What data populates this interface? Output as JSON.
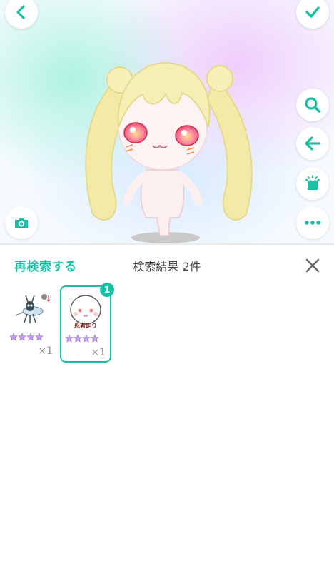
{
  "toolbar": {
    "back_icon": "chevron-left-icon",
    "confirm_icon": "checkmark-icon",
    "search_icon": "search-icon",
    "undo_icon": "arrow-left-icon",
    "outfit_icon": "shirt-sparkle-icon",
    "camera_icon": "camera-icon",
    "more_icon": "more-dots-icon",
    "accent_color": "#19c0a6"
  },
  "results_panel": {
    "research_label": "再検索する",
    "title": "検索結果 2件",
    "close_icon": "close-icon"
  },
  "items": [
    {
      "icon": "mosquito-item-icon",
      "rarity_stars": 4,
      "count": "×1",
      "selected": false
    },
    {
      "icon": "face-item-icon",
      "label": "忍者走り",
      "rarity_stars": 4,
      "count": "×1",
      "selected": true,
      "badge": "1"
    }
  ]
}
